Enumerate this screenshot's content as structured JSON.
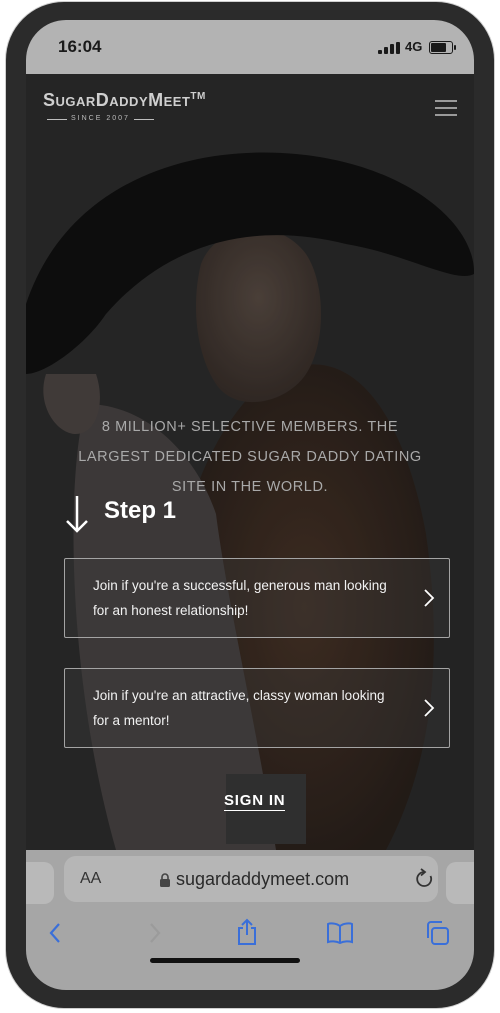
{
  "status_bar": {
    "time": "16:04",
    "network": "4G"
  },
  "site": {
    "brand_name": "SugarDaddyMeet",
    "brand_tm": "TM",
    "brand_since": "SINCE 2007",
    "tagline": "8 MILLION+ SELECTIVE MEMBERS. THE LARGEST DEDICATED SUGAR DADDY DATING SITE IN THE WORLD.",
    "step_label": "Step 1",
    "options": [
      {
        "label": "Join if you're a successful, generous man looking for an honest relationship!"
      },
      {
        "label": "Join if you're an attractive, classy woman looking for a mentor!"
      }
    ],
    "sign_in_label": "SIGN IN"
  },
  "browser": {
    "text_size_label": "AA",
    "url": "sugardaddymeet.com",
    "toolbar_icons": [
      "back-icon",
      "forward-icon",
      "share-icon",
      "bookmarks-icon",
      "tabs-icon"
    ]
  },
  "colors": {
    "accent_blue": "#3a6fd9",
    "overlay": "#2a2a2a"
  }
}
